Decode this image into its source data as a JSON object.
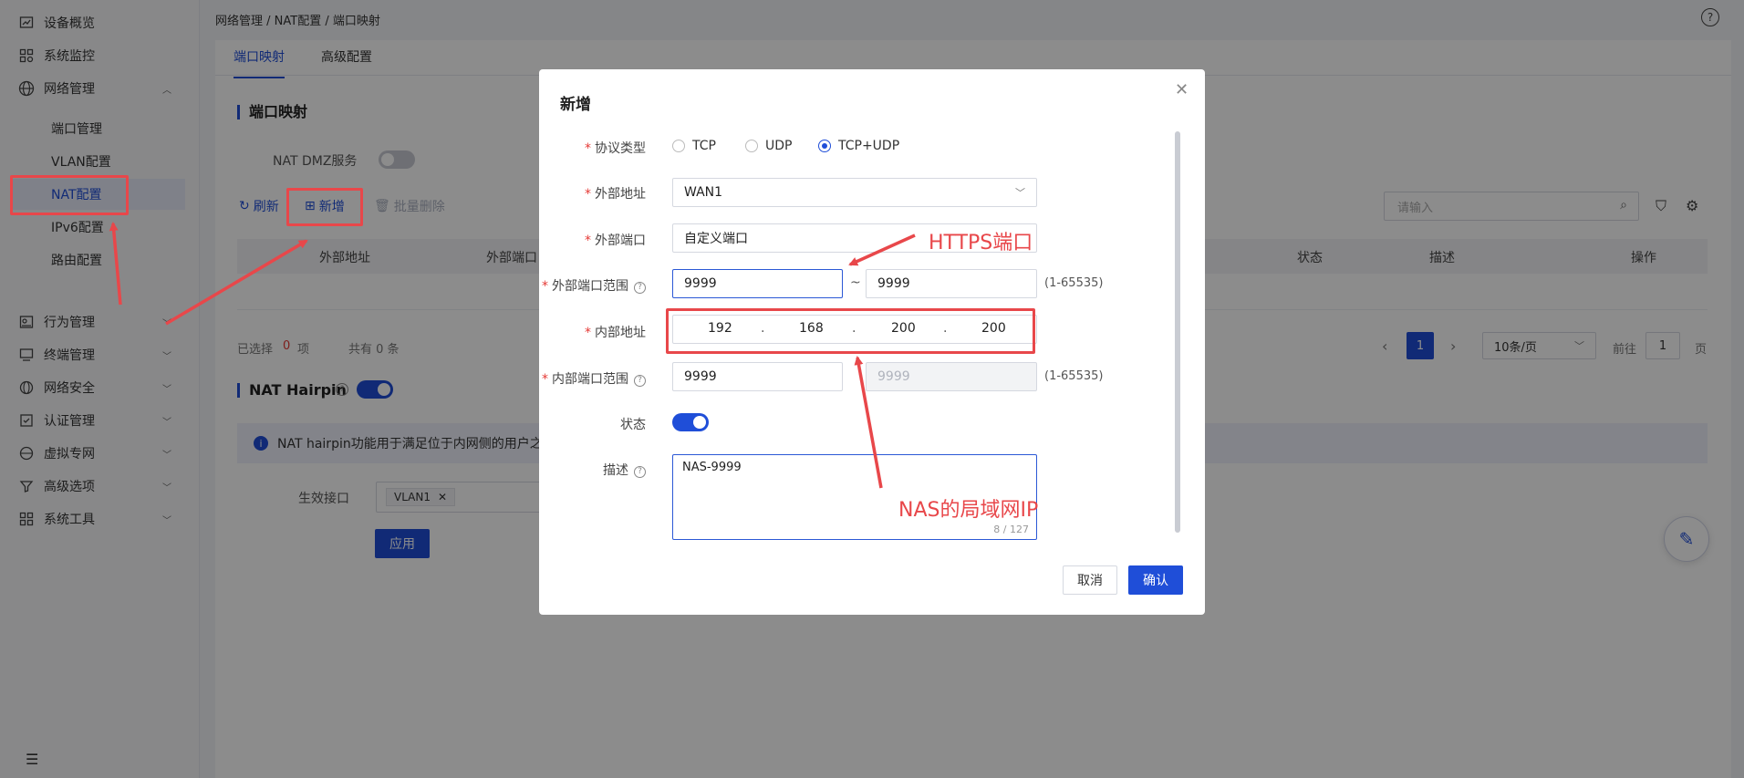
{
  "sidebar": {
    "items": [
      {
        "label": "设备概览",
        "icon": "chart-icon"
      },
      {
        "label": "系统监控",
        "icon": "monitor-icon"
      },
      {
        "label": "网络管理",
        "icon": "globe-icon"
      },
      {
        "label": "行为管理",
        "icon": "behavior-icon"
      },
      {
        "label": "终端管理",
        "icon": "terminal-icon"
      },
      {
        "label": "网络安全",
        "icon": "security-icon"
      },
      {
        "label": "认证管理",
        "icon": "auth-icon"
      },
      {
        "label": "虚拟专网",
        "icon": "vpn-icon"
      },
      {
        "label": "高级选项",
        "icon": "filter-icon"
      },
      {
        "label": "系统工具",
        "icon": "tools-icon"
      }
    ],
    "sub_items": [
      "端口管理",
      "VLAN配置",
      "NAT配置",
      "IPv6配置",
      "路由配置"
    ]
  },
  "header": {
    "breadcrumb": "网络管理 / NAT配置 / 端口映射"
  },
  "tabs": [
    "端口映射",
    "高级配置"
  ],
  "port_mapping": {
    "title": "端口映射",
    "dmz_label": "NAT DMZ服务",
    "refresh": "刷新",
    "add": "新增",
    "batch_delete": "批量删除",
    "search_placeholder": "请输入",
    "columns": [
      "外部地址",
      "外部端口",
      "状态",
      "描述",
      "操作"
    ],
    "selected_prefix": "已选择",
    "selected_count": "0",
    "selected_suffix": "项",
    "total": "共有 0 条",
    "page": "1",
    "page_size": "10条/页",
    "goto": "前往",
    "goto_value": "1",
    "page_suffix": "页"
  },
  "hairpin": {
    "title": "NAT Hairpin",
    "info": "NAT hairpin功能用于满足位于内网侧的用户之间",
    "interface_label": "生效接口",
    "interface_tag": "VLAN1",
    "apply": "应用"
  },
  "modal": {
    "title": "新增",
    "protocol_label": "协议类型",
    "protocols": [
      "TCP",
      "UDP",
      "TCP+UDP"
    ],
    "selected_protocol": "TCP+UDP",
    "ext_addr_label": "外部地址",
    "ext_addr_value": "WAN1",
    "ext_port_label": "外部端口",
    "ext_port_value": "自定义端口",
    "ext_range_label": "外部端口范围",
    "ext_range_from": "9999",
    "ext_range_to": "9999",
    "range_sep": "~",
    "range_hint": "(1-65535)",
    "int_addr_label": "内部地址",
    "ip": [
      "192",
      "168",
      "200",
      "200"
    ],
    "ip_dot": ".",
    "int_range_label": "内部端口范围",
    "int_range_from": "9999",
    "int_range_to": "9999",
    "status_label": "状态",
    "desc_label": "描述",
    "desc_value": "NAS-9999",
    "desc_counter": "8 / 127",
    "cancel": "取消",
    "confirm": "确认"
  },
  "annotations": {
    "https_label": "HTTPS端口",
    "nas_label": "NAS的局域网IP",
    "color": "#e8474a"
  }
}
